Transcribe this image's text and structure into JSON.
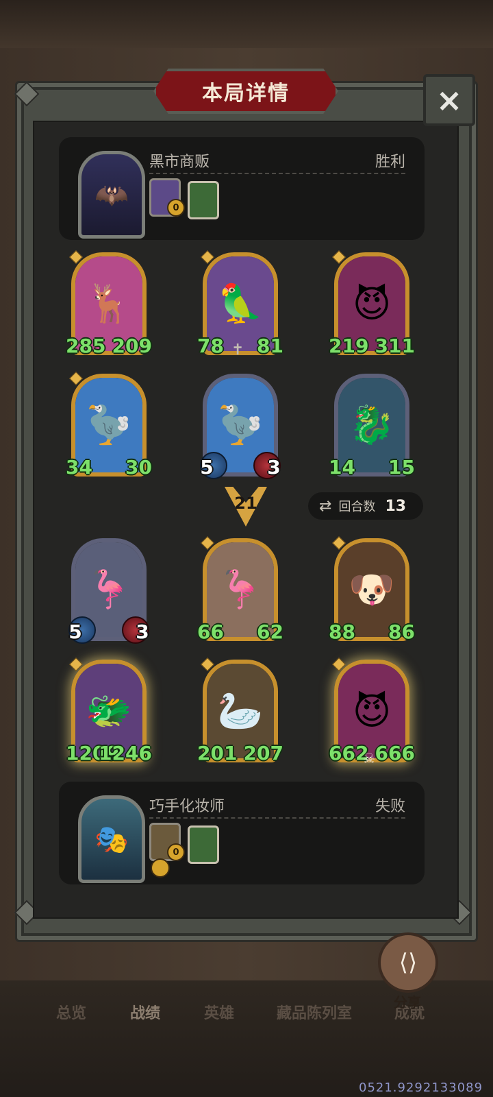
{
  "dialog": {
    "title": "本局详情",
    "close_icon": "×"
  },
  "winner": {
    "name": "黑市商贩",
    "result": "胜利",
    "portrait_icon": "🦇",
    "items": [
      {
        "icon": "door-icon",
        "count": "0"
      },
      {
        "icon": "book-icon"
      }
    ]
  },
  "loser": {
    "name": "巧手化妆师",
    "result": "失败",
    "portrait_icon": "🎭",
    "items": [
      {
        "icon": "door-icon",
        "count": "0"
      },
      {
        "icon": "book-icon"
      },
      {
        "icon": "coin-icon"
      }
    ]
  },
  "top_board": [
    {
      "attack": "285",
      "health": "209",
      "art": "🦌",
      "bg": "#b54b8a"
    },
    {
      "attack": "78",
      "health": "81",
      "art": "🦜",
      "bg": "#6a4a8e"
    },
    {
      "attack": "219",
      "health": "311",
      "art": "😈",
      "bg": "#7a2b5a"
    },
    {
      "attack": "34",
      "health": "30",
      "art": "🦤",
      "bg": "#3e7ac0"
    },
    {
      "attack": "5",
      "health": "3",
      "art": "🦤",
      "bg": "#3e7ac0"
    },
    {
      "attack": "14",
      "health": "15",
      "art": "🐉",
      "bg": "#33556a"
    }
  ],
  "bottom_board": [
    {
      "attack": "5",
      "health": "3",
      "art": "🦩",
      "bg": "#5a5f79"
    },
    {
      "attack": "66",
      "health": "62",
      "art": "🦩",
      "bg": "#8b6f5e"
    },
    {
      "attack": "88",
      "health": "86",
      "art": "🐶",
      "bg": "#5a3f2a"
    },
    {
      "attack": "1209",
      "health": "1246",
      "art": "🐲",
      "bg": "#5e3f7a"
    },
    {
      "attack": "201",
      "health": "207",
      "art": "🦢",
      "bg": "#5b4a33"
    },
    {
      "attack": "662",
      "health": "666",
      "art": "😈",
      "bg": "#7a2b5a"
    }
  ],
  "damage": {
    "value": "21"
  },
  "rounds": {
    "label": "回合数",
    "value": "13",
    "icon": "refresh-icon"
  },
  "share": {
    "label": "分享",
    "icon": "share-icon"
  },
  "nav": [
    {
      "label": "总览"
    },
    {
      "label": "战绩"
    },
    {
      "label": "英雄"
    },
    {
      "label": "藏品陈列室"
    },
    {
      "label": "成就"
    }
  ],
  "watermark": "0521.9292133089"
}
